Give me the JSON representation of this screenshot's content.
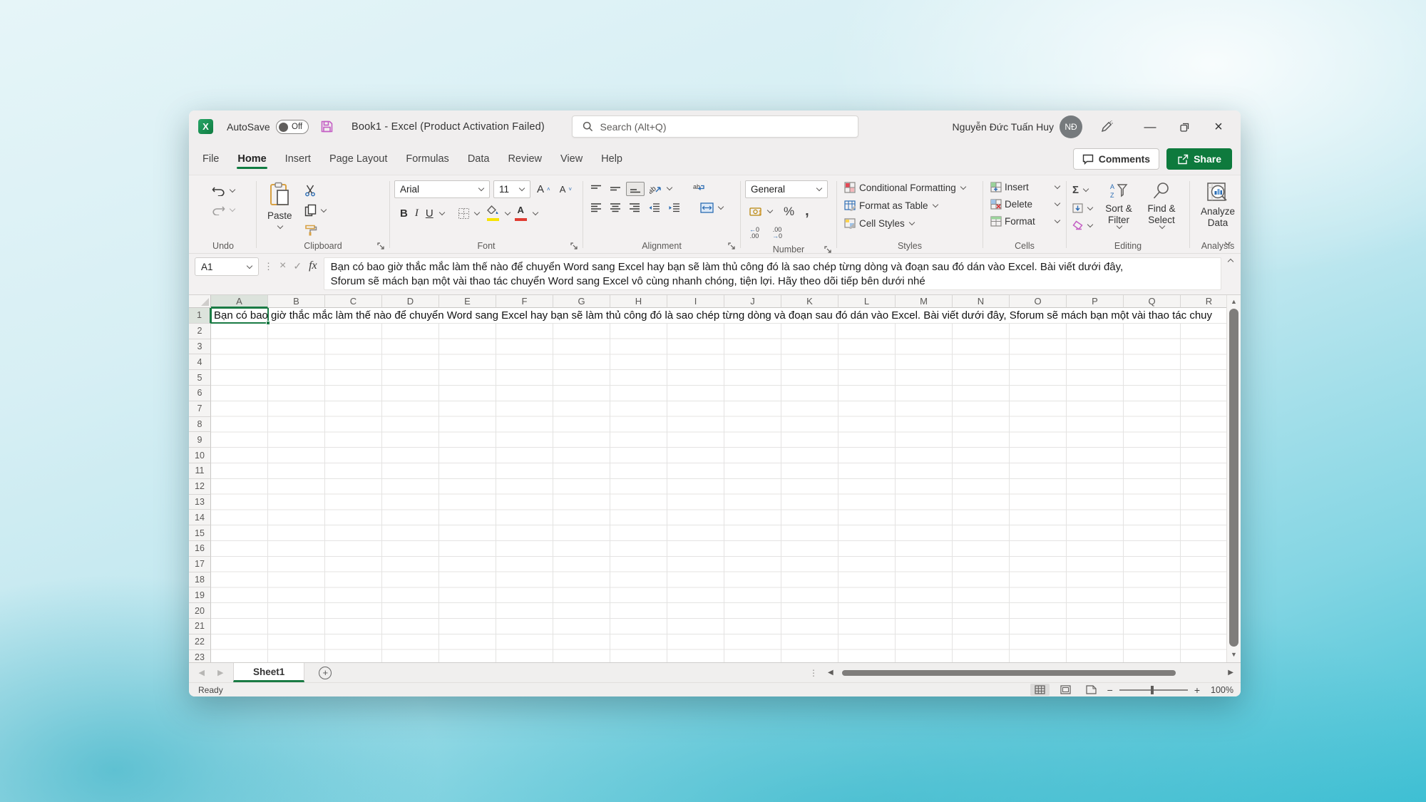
{
  "colors": {
    "excel_green": "#107C41",
    "selection_border": "#1a7b44",
    "share_button": "#0e7a3d",
    "save_icon": "#c45ec4",
    "fill_yellow": "#f7e300",
    "font_red": "#e03c31"
  },
  "title_bar": {
    "autosave_label": "AutoSave",
    "autosave_state": "Off",
    "title": "Book1  -  Excel (Product Activation Failed)",
    "search_placeholder": "Search (Alt+Q)",
    "user_name": "Nguyễn Đức Tuấn Huy",
    "user_initials": "NĐ"
  },
  "ribbon_tabs": [
    {
      "label": "File",
      "active": false
    },
    {
      "label": "Home",
      "active": true
    },
    {
      "label": "Insert",
      "active": false
    },
    {
      "label": "Page Layout",
      "active": false
    },
    {
      "label": "Formulas",
      "active": false
    },
    {
      "label": "Data",
      "active": false
    },
    {
      "label": "Review",
      "active": false
    },
    {
      "label": "View",
      "active": false
    },
    {
      "label": "Help",
      "active": false
    }
  ],
  "actions": {
    "comments_label": "Comments",
    "share_label": "Share"
  },
  "ribbon": {
    "groups": {
      "undo": "Undo",
      "clipboard": "Clipboard",
      "font": "Font",
      "alignment": "Alignment",
      "number": "Number",
      "styles": "Styles",
      "cells": "Cells",
      "editing": "Editing",
      "analysis": "Analysis"
    },
    "paste_label": "Paste",
    "font_name": "Arial",
    "font_size": "11",
    "number_format": "General",
    "styles_items": [
      "Conditional Formatting",
      "Format as Table",
      "Cell Styles"
    ],
    "cells_items": [
      "Insert",
      "Delete",
      "Format"
    ],
    "sort_filter_label": "Sort & Filter",
    "find_select_label": "Find & Select",
    "analyze_data_label": "Analyze Data"
  },
  "formula_bar": {
    "cell_reference": "A1",
    "fx_label": "fx",
    "line1": "Bạn có bao giờ thắc mắc làm thế nào để chuyển Word sang Excel hay bạn sẽ làm thủ công đó là sao chép từng dòng và đoạn sau đó dán vào Excel. Bài viết dưới đây,",
    "line2": "Sforum sẽ mách bạn một vài thao tác chuyển Word sang Excel vô cùng nhanh chóng, tiện lợi. Hãy theo dõi tiếp bên dưới nhé"
  },
  "grid": {
    "columns": [
      "A",
      "B",
      "C",
      "D",
      "E",
      "F",
      "G",
      "H",
      "I",
      "J",
      "K",
      "L",
      "M",
      "N",
      "O",
      "P",
      "Q",
      "R"
    ],
    "rows": [
      1,
      2,
      3,
      4,
      5,
      6,
      7,
      8,
      9,
      10,
      11,
      12,
      13,
      14,
      15,
      16,
      17,
      18,
      19,
      20,
      21,
      22,
      23
    ],
    "active_cell": "A1",
    "a1_text": "Bạn có bao giờ thắc mắc làm thế nào để chuyển Word sang Excel hay bạn sẽ làm thủ công đó là sao chép từng dòng và đoạn sau đó dán vào Excel. Bài viết dưới đây, Sforum sẽ mách bạn một vài thao tác chuyển Word sang Excel vô cùng nhanh chóng, tiện lợi. Hãy theo dõi tiếp bên dưới nhé"
  },
  "sheet_strip": {
    "tabs": [
      {
        "label": "Sheet1",
        "active": true
      }
    ]
  },
  "status_bar": {
    "ready_label": "Ready",
    "zoom_level": "100%"
  }
}
